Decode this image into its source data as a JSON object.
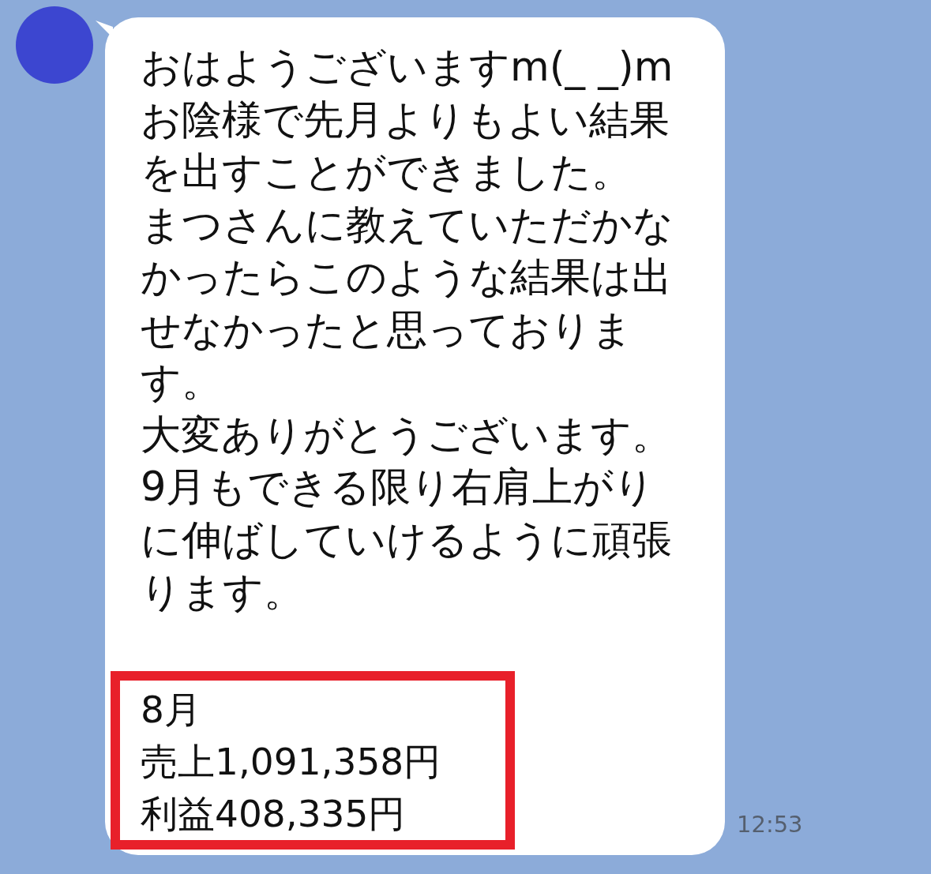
{
  "message": {
    "paragraphs": [
      "おはようございますm(_ _)m",
      "お陰様で先月よりもよい結果を出すことができました。",
      "まつさんに教えていただかなかったらこのような結果は出せなかったと思っております。",
      "大変ありがとうございます。",
      "9月もできる限り右肩上がりに伸ばしていけるように頑張ります。"
    ],
    "highlight": [
      "8月",
      "売上1,091,358円",
      "利益408,335円"
    ],
    "time": "12:53"
  }
}
